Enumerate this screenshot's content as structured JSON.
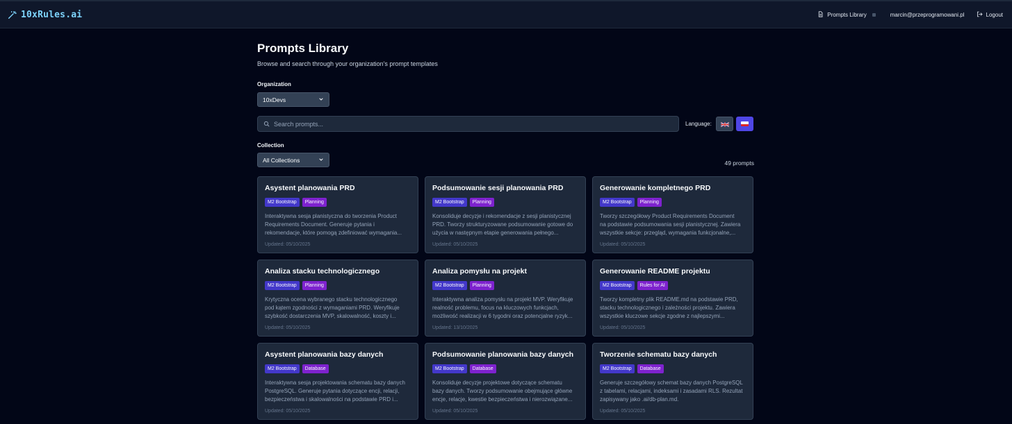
{
  "app": {
    "brand": "10xRules.ai"
  },
  "topnav": {
    "library_link": "Prompts Library",
    "user_email": "marcin@przeprogramowani.pl",
    "logout_label": "Logout"
  },
  "page": {
    "title": "Prompts Library",
    "subtitle": "Browse and search through your organization's prompt templates"
  },
  "filters": {
    "organization_label": "Organization",
    "organization_value": "10xDevs",
    "search_placeholder": "Search prompts...",
    "language_label": "Language:",
    "languages": [
      "en",
      "pl"
    ],
    "selected_language": "pl",
    "collection_label": "Collection",
    "collection_value": "All Collections",
    "count_text": "49 prompts"
  },
  "colors": {
    "background": "#020617",
    "card": "#1e293b",
    "collection_tag": "#4338ca",
    "category_tag": "#7e22ce",
    "accent": "#4f46e5",
    "brand": "#7dd3fc"
  },
  "cards": [
    {
      "title": "Asystent planowania PRD",
      "collection": "M2 Bootstrap",
      "category": "Planning",
      "description": [
        "Interaktywna sesja planistyczna do tworzenia Product",
        "Requirements Document. Generuje pytania i",
        "rekomendacje, które pomogą zdefiniować wymagania..."
      ],
      "updated": "Updated: 05/10/2025"
    },
    {
      "title": "Podsumowanie sesji planowania PRD",
      "collection": "M2 Bootstrap",
      "category": "Planning",
      "description": [
        "Konsoliduje decyzje i rekomendacje z sesji planistycznej",
        "PRD. Tworzy strukturyzowane podsumowanie gotowe do",
        "użycia w następnym etapie generowania pełnego..."
      ],
      "updated": "Updated: 05/10/2025"
    },
    {
      "title": "Generowanie kompletnego PRD",
      "collection": "M2 Bootstrap",
      "category": "Planning",
      "description": [
        "Tworzy szczegółowy Product Requirements Document",
        "na podstawie podsumowania sesji planistycznej. Zawiera",
        "wszystkie sekcje: przegląd, wymagania funkcjonalne,..."
      ],
      "updated": "Updated: 05/10/2025"
    },
    {
      "title": "Analiza stacku technologicznego",
      "collection": "M2 Bootstrap",
      "category": "Planning",
      "description": [
        "Krytyczna ocena wybranego stacku technologicznego",
        "pod kątem zgodności z wymaganiami PRD. Weryfikuje",
        "szybkość dostarczenia MVP, skalowalność, koszty i..."
      ],
      "updated": "Updated: 05/10/2025"
    },
    {
      "title": "Analiza pomysłu na projekt",
      "collection": "M2 Bootstrap",
      "category": "Planning",
      "description": [
        "Interaktywna analiza pomysłu na projekt MVP. Weryfikuje",
        "realność problemu, focus na kluczowych funkcjach,",
        "możliwość realizacji w 6 tygodni oraz potencjalne ryzyk..."
      ],
      "updated": "Updated: 13/10/2025"
    },
    {
      "title": "Generowanie README projektu",
      "collection": "M2 Bootstrap",
      "category": "Rules for AI",
      "description": [
        "Tworzy kompletny plik README.md na podstawie PRD,",
        "stacku technologicznego i zależności projektu. Zawiera",
        "wszystkie kluczowe sekcje zgodne z najlepszymi..."
      ],
      "updated": "Updated: 05/10/2025"
    },
    {
      "title": "Asystent planowania bazy danych",
      "collection": "M2 Bootstrap",
      "category": "Database",
      "description": [
        "Interaktywna sesja projektowania schematu bazy danych",
        "PostgreSQL. Generuje pytania dotyczące encji, relacji,",
        "bezpieczeństwa i skalowalności na podstawie PRD i..."
      ],
      "updated": "Updated: 05/10/2025"
    },
    {
      "title": "Podsumowanie planowania bazy danych",
      "collection": "M2 Bootstrap",
      "category": "Database",
      "description": [
        "Konsoliduje decyzje projektowe dotyczące schematu",
        "bazy danych. Tworzy podsumowanie obejmujące główne",
        "encje, relacje, kwestie bezpieczeństwa i nierozwiązane..."
      ],
      "updated": "Updated: 05/10/2025"
    },
    {
      "title": "Tworzenie schematu bazy danych",
      "collection": "M2 Bootstrap",
      "category": "Database",
      "description": [
        "Generuje szczegółowy schemat bazy danych PostgreSQL",
        "z tabelami, relacjami, indeksami i zasadami RLS. Rezultat",
        "zapisywany jako .ai/db-plan.md."
      ],
      "updated": "Updated: 05/10/2025"
    }
  ]
}
